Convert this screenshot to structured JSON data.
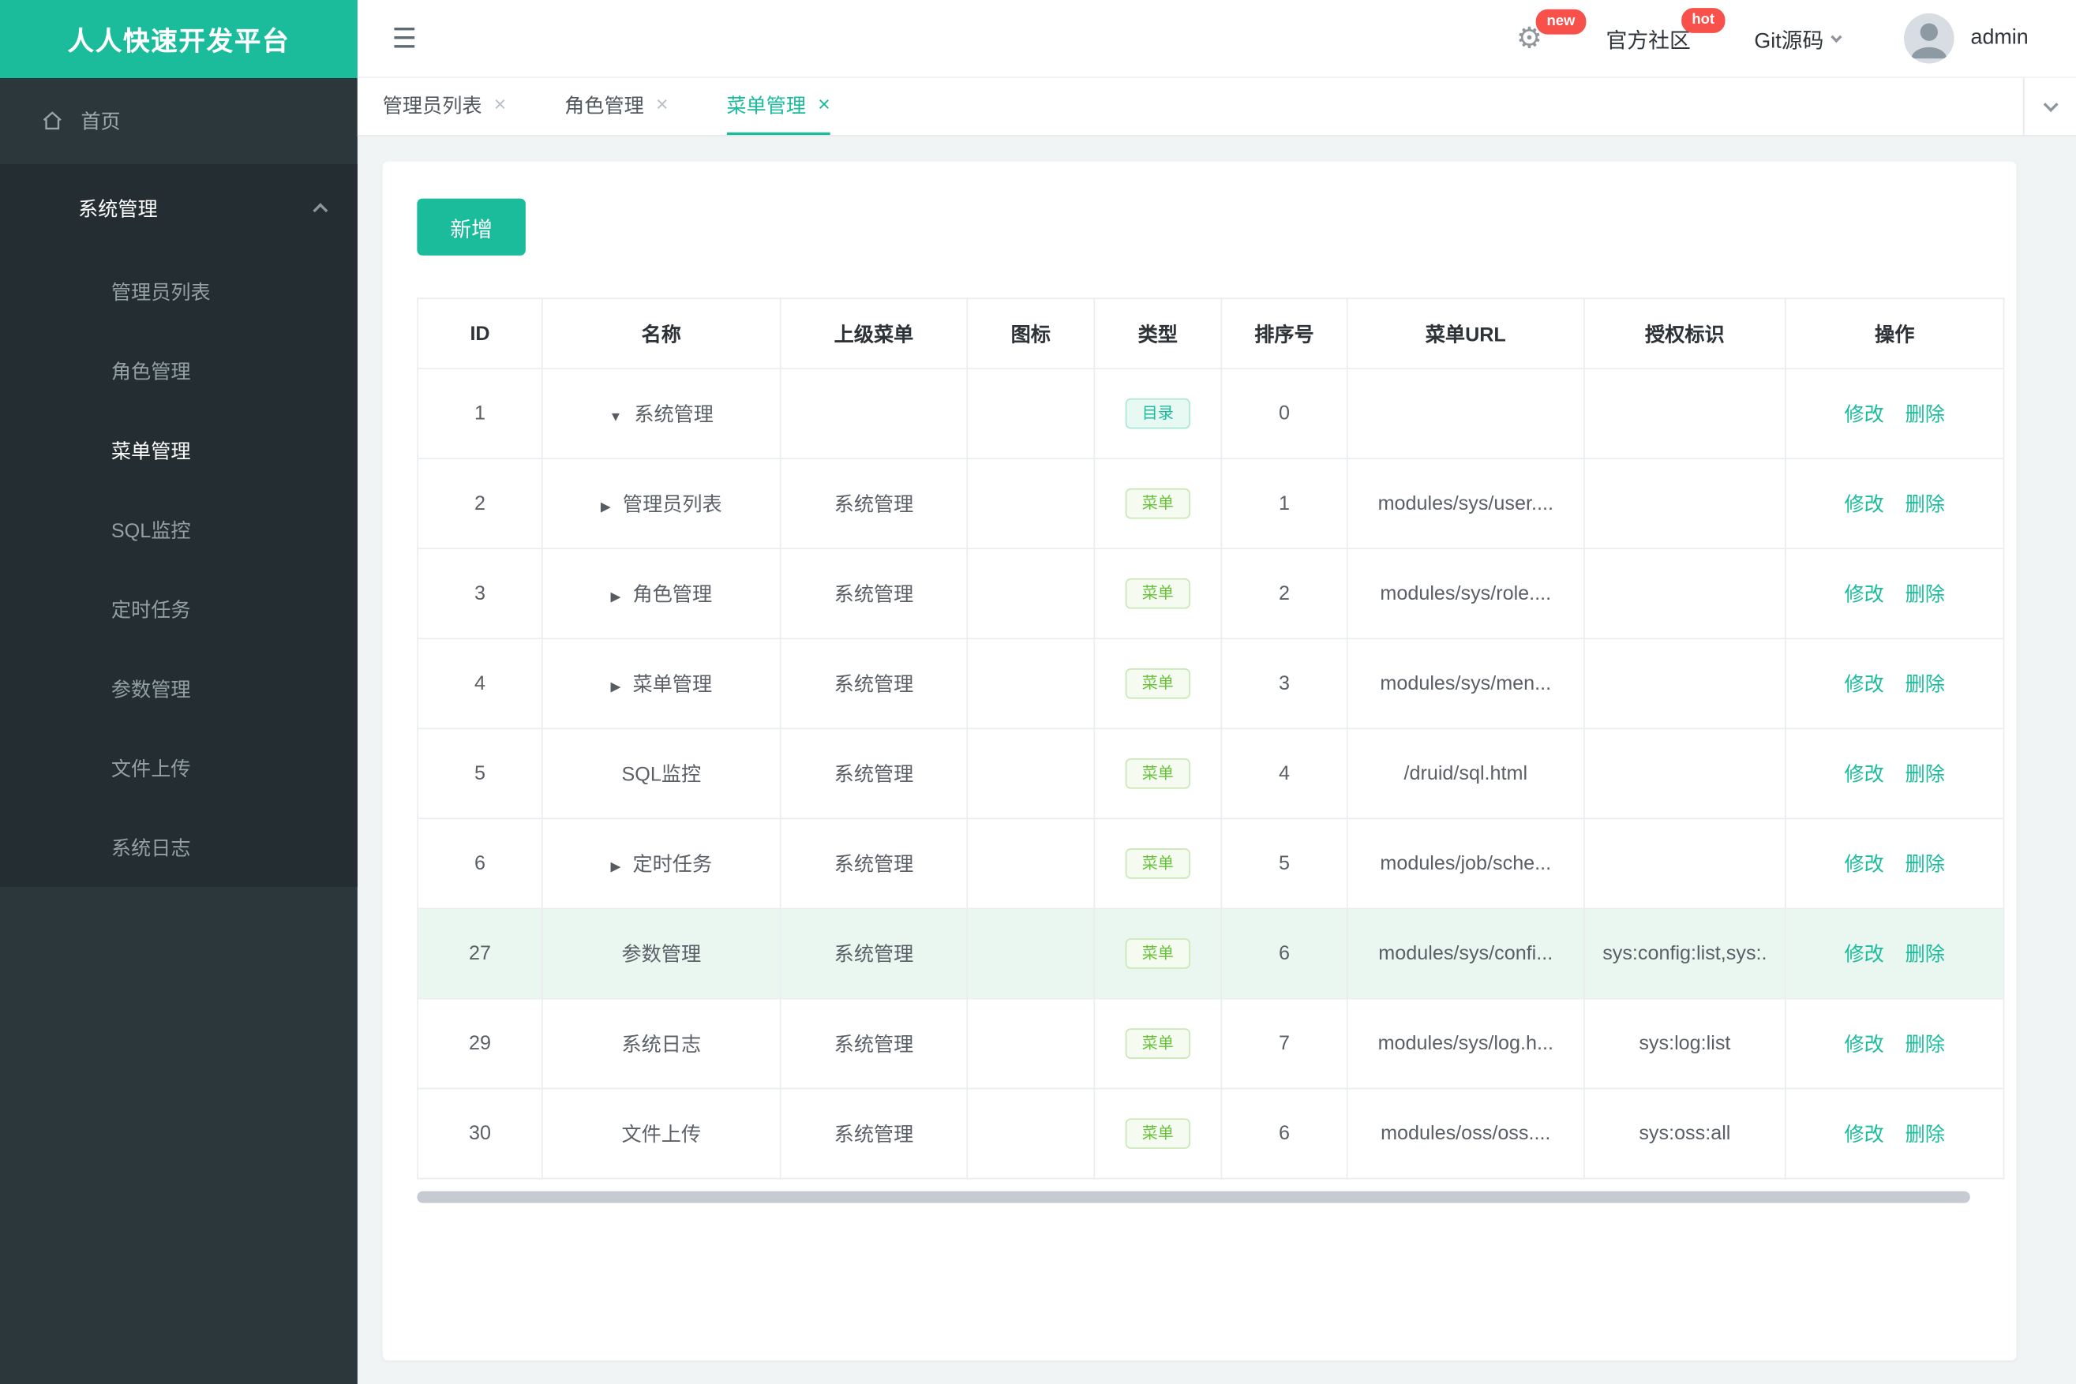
{
  "app": {
    "title": "人人快速开发平台"
  },
  "icons": {
    "hamburger": "☰",
    "gear": "⚙",
    "close": "×",
    "arrow_down": "▼",
    "arrow_right": "▶"
  },
  "header": {
    "community": "官方社区",
    "git": "Git源码",
    "username": "admin",
    "badge_new": "new",
    "badge_hot": "hot"
  },
  "sidebar": {
    "home": "首页",
    "group": "系统管理",
    "items": [
      "管理员列表",
      "角色管理",
      "菜单管理",
      "SQL监控",
      "定时任务",
      "参数管理",
      "文件上传",
      "系统日志"
    ],
    "active_item": "菜单管理"
  },
  "tabs": [
    {
      "label": "管理员列表",
      "active": false
    },
    {
      "label": "角色管理",
      "active": false
    },
    {
      "label": "菜单管理",
      "active": true
    }
  ],
  "toolbar": {
    "add_label": "新增"
  },
  "table": {
    "headers": [
      "ID",
      "名称",
      "上级菜单",
      "图标",
      "类型",
      "排序号",
      "菜单URL",
      "授权标识",
      "操作"
    ],
    "actions": {
      "edit": "修改",
      "delete": "删除"
    },
    "rows": [
      {
        "id": "1",
        "arrow": "down",
        "name": "系统管理",
        "parent": "",
        "type": "目录",
        "type_kind": "dir",
        "order": "0",
        "url": "",
        "perm": "",
        "highlight": false
      },
      {
        "id": "2",
        "arrow": "right",
        "name": "管理员列表",
        "parent": "系统管理",
        "type": "菜单",
        "type_kind": "menu",
        "order": "1",
        "url": "modules/sys/user....",
        "perm": "",
        "highlight": false
      },
      {
        "id": "3",
        "arrow": "right",
        "name": "角色管理",
        "parent": "系统管理",
        "type": "菜单",
        "type_kind": "menu",
        "order": "2",
        "url": "modules/sys/role....",
        "perm": "",
        "highlight": false
      },
      {
        "id": "4",
        "arrow": "right",
        "name": "菜单管理",
        "parent": "系统管理",
        "type": "菜单",
        "type_kind": "menu",
        "order": "3",
        "url": "modules/sys/men...",
        "perm": "",
        "highlight": false
      },
      {
        "id": "5",
        "arrow": "",
        "name": "SQL监控",
        "parent": "系统管理",
        "type": "菜单",
        "type_kind": "menu",
        "order": "4",
        "url": "/druid/sql.html",
        "perm": "",
        "highlight": false
      },
      {
        "id": "6",
        "arrow": "right",
        "name": "定时任务",
        "parent": "系统管理",
        "type": "菜单",
        "type_kind": "menu",
        "order": "5",
        "url": "modules/job/sche...",
        "perm": "",
        "highlight": false
      },
      {
        "id": "27",
        "arrow": "",
        "name": "参数管理",
        "parent": "系统管理",
        "type": "菜单",
        "type_kind": "menu",
        "order": "6",
        "url": "modules/sys/confi...",
        "perm": "sys:config:list,sys:.",
        "highlight": true
      },
      {
        "id": "29",
        "arrow": "",
        "name": "系统日志",
        "parent": "系统管理",
        "type": "菜单",
        "type_kind": "menu",
        "order": "7",
        "url": "modules/sys/log.h...",
        "perm": "sys:log:list",
        "highlight": false
      },
      {
        "id": "30",
        "arrow": "",
        "name": "文件上传",
        "parent": "系统管理",
        "type": "菜单",
        "type_kind": "menu",
        "order": "6",
        "url": "modules/oss/oss....",
        "perm": "sys:oss:all",
        "highlight": false
      }
    ]
  },
  "colors": {
    "accent": "#1abc9c",
    "badge_red": "#f8504b",
    "tag_green": "#67c23a",
    "row_highlight": "#eaf7f1"
  }
}
